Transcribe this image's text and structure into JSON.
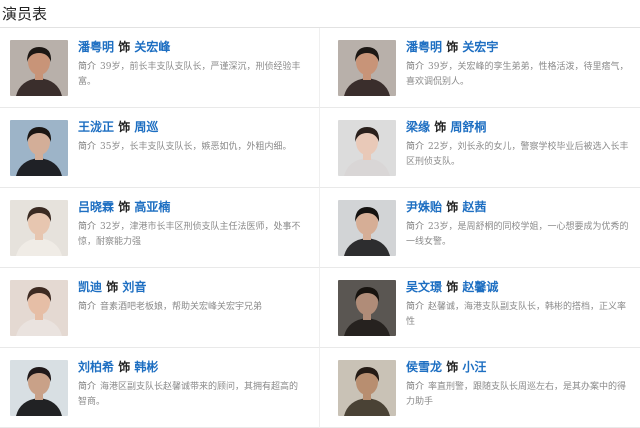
{
  "page_title": "演员表",
  "shi": "饰",
  "intro_label": "简介",
  "cast": [
    {
      "actor": "潘粤明",
      "role": "关宏峰",
      "intro": "39岁，前长丰支队支队长，严谨深沉，刑侦经验丰富。",
      "colors": {
        "bg": "#b8b0aa",
        "skin": "#c89478",
        "hair": "#1c1714",
        "cloth": "#3a2e2c"
      }
    },
    {
      "actor": "潘粤明",
      "role": "关宏宇",
      "intro": "39岁，关宏峰的孪生弟弟，性格活泼，待里痞气，喜欢调侃别人。",
      "colors": {
        "bg": "#b8b0aa",
        "skin": "#c89478",
        "hair": "#1c1714",
        "cloth": "#3a2e2c"
      }
    },
    {
      "actor": "王泷正",
      "role": "周巡",
      "intro": "35岁，长丰支队支队长，嫉恶如仇，外粗内细。",
      "colors": {
        "bg": "#9db4c8",
        "skin": "#d3ae98",
        "hair": "#1b1613",
        "cloth": "#1f2126"
      }
    },
    {
      "actor": "梁缘",
      "role": "周舒桐",
      "intro": "22岁，刘长永的女儿，警察学校毕业后被选入长丰区刑侦支队。",
      "colors": {
        "bg": "#dcdcdc",
        "skin": "#e9c9b8",
        "hair": "#2a201c",
        "cloth": "#d9d6d6"
      }
    },
    {
      "actor": "吕晓霖",
      "role": "高亚楠",
      "intro": "32岁，津港市长丰区刑侦支队主任法医师，处事不惊，耐察能力强",
      "colors": {
        "bg": "#e6e2dc",
        "skin": "#e7c6b0",
        "hair": "#3a2a22",
        "cloth": "#f0ece6"
      }
    },
    {
      "actor": "尹姝贻",
      "role": "赵茜",
      "intro": "23岁，是周舒桐的同校学姐，一心想要成为优秀的一线女警。",
      "colors": {
        "bg": "#d2d4d6",
        "skin": "#d6ae96",
        "hair": "#141210",
        "cloth": "#2d2d2f"
      }
    },
    {
      "actor": "凯迪",
      "role": "刘音",
      "intro": "音素酒吧老板娘，帮助关宏峰关宏宇兄弟",
      "colors": {
        "bg": "#e4d9d2",
        "skin": "#e6bea6",
        "hair": "#3d2a22",
        "cloth": "#eae3df"
      }
    },
    {
      "actor": "吴文璟",
      "role": "赵馨诚",
      "intro": "赵馨诚，海港支队副支队长，韩彬的搭档，正义率性",
      "colors": {
        "bg": "#5a5652",
        "skin": "#b08c78",
        "hair": "#17130f",
        "cloth": "#26221f"
      }
    },
    {
      "actor": "刘柏希",
      "role": "韩彬",
      "intro": "海港区副支队长赵馨诚带来的顾问，其拥有超高的智商。",
      "colors": {
        "bg": "#d8dfe3",
        "skin": "#c9a188",
        "hair": "#20191a",
        "cloth": "#212224"
      }
    },
    {
      "actor": "侯雪龙",
      "role": "小汪",
      "intro": "率直刑警，跟随支队长周巡左右，是其办案中的得力助手",
      "colors": {
        "bg": "#c9c2b6",
        "skin": "#b88e70",
        "hair": "#241b15",
        "cloth": "#4a4235"
      }
    }
  ]
}
